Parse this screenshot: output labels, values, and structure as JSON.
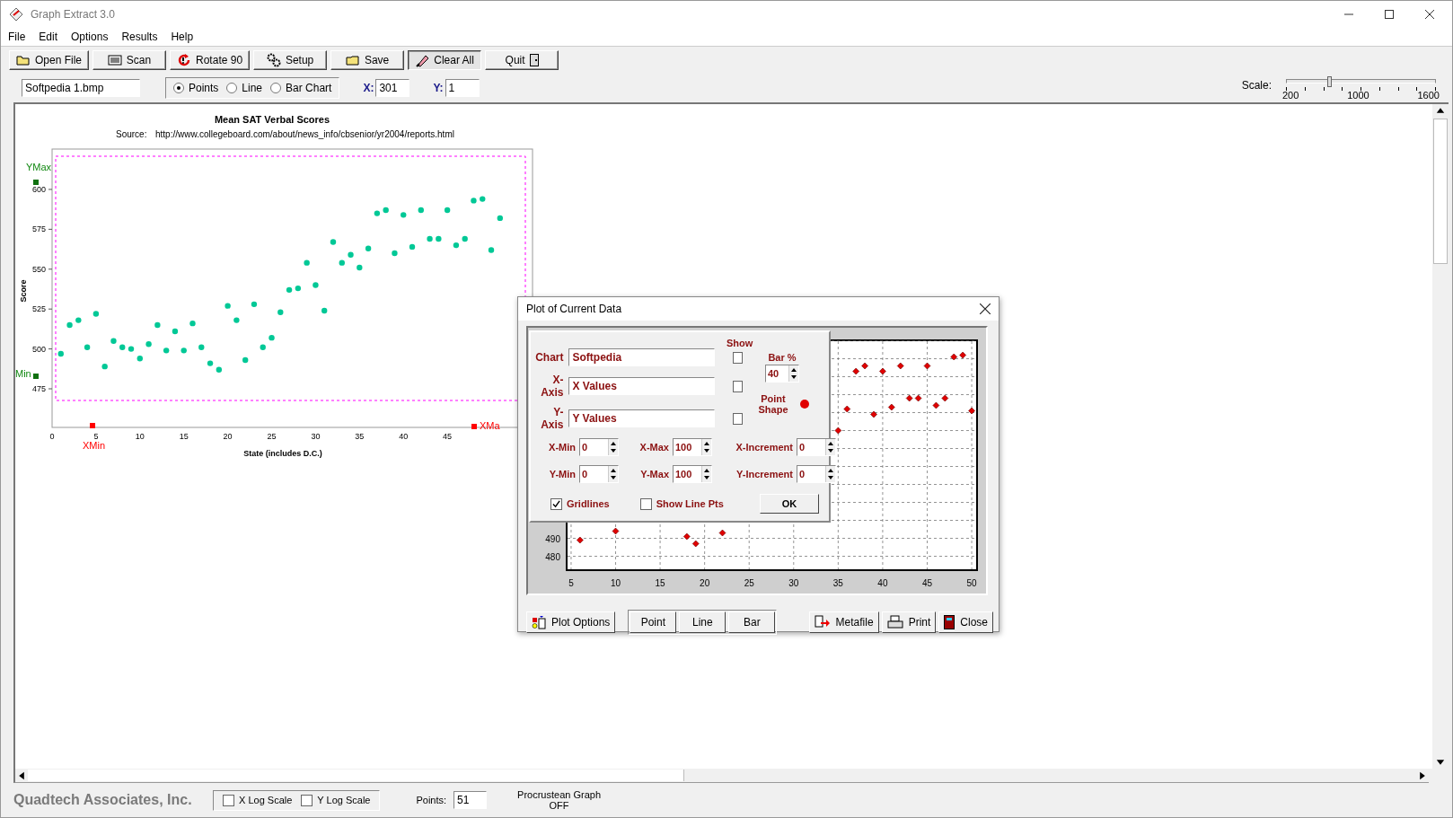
{
  "window": {
    "title": "Graph Extract 3.0"
  },
  "menu": [
    "File",
    "Edit",
    "Options",
    "Results",
    "Help"
  ],
  "toolbar": [
    {
      "label": "Open File",
      "kind": "folder",
      "pressed": false
    },
    {
      "label": "Scan",
      "kind": "scan",
      "pressed": false
    },
    {
      "label": "Rotate 90",
      "kind": "rotate",
      "pressed": false
    },
    {
      "label": "Setup",
      "kind": "gear",
      "pressed": false
    },
    {
      "label": "Save",
      "kind": "save",
      "pressed": false
    },
    {
      "label": "Clear All",
      "kind": "eraser",
      "pressed": true
    },
    {
      "label": "Quit",
      "kind": "door",
      "pressed": false
    }
  ],
  "file_field": {
    "value": "Softpedia 1.bmp"
  },
  "plot_type": [
    {
      "label": "Points",
      "selected": true
    },
    {
      "label": "Line",
      "selected": false
    },
    {
      "label": "Bar Chart",
      "selected": false
    }
  ],
  "x_field": {
    "label": "X:",
    "value": "301"
  },
  "y_field": {
    "label": "Y:",
    "value": "1"
  },
  "scale": {
    "label": "Scale:",
    "level": 0.29,
    "ticks": [
      "200",
      "1000",
      "1600"
    ]
  },
  "image_chart": {
    "title": "Mean SAT Verbal Scores",
    "source_label": "Source:",
    "source_url": "http://www.collegeboard.com/about/news_info/cbsenior/yr2004/reports.html",
    "markers": {
      "ymax": "YMax",
      "ymin": "Min",
      "xmin": "XMin",
      "xmax": "XMa"
    },
    "chart_data": {
      "type": "scatter",
      "xlabel": "State (includes D.C.)",
      "ylabel": "Score",
      "x": [
        1,
        2,
        3,
        4,
        5,
        6,
        7,
        8,
        9,
        10,
        11,
        12,
        13,
        14,
        15,
        16,
        17,
        18,
        19,
        20,
        21,
        22,
        23,
        24,
        25,
        26,
        27,
        28,
        29,
        30,
        31,
        32,
        33,
        34,
        35,
        36,
        37,
        38,
        39,
        40,
        41,
        42,
        43,
        44,
        45,
        46,
        47,
        48,
        49,
        50,
        51
      ],
      "series": [
        {
          "color": "#00c896",
          "values": [
            497,
            515,
            518,
            501,
            522,
            489,
            505,
            501,
            500,
            494,
            503,
            515,
            499,
            511,
            499,
            516,
            501,
            491,
            487,
            527,
            518,
            493,
            528,
            501,
            507,
            523,
            537,
            538,
            554,
            540,
            524,
            567,
            554,
            559,
            551,
            563,
            585,
            587,
            560,
            584,
            564,
            587,
            569,
            569,
            587,
            565,
            569,
            593,
            594,
            562,
            582
          ]
        }
      ],
      "xticks": [
        0,
        5,
        10,
        15,
        20,
        25,
        30,
        35,
        40,
        45
      ],
      "yticks": [
        475,
        500,
        525,
        550,
        575,
        600
      ],
      "xlim": [
        0,
        54.7
      ],
      "ylim": [
        450.8,
        625.3
      ]
    }
  },
  "dialog": {
    "title": "Plot of Current Data",
    "chart_data": {
      "type": "scatter",
      "x": [
        6,
        10,
        18,
        19,
        22,
        35,
        36,
        37,
        38,
        39,
        40,
        41,
        42,
        43,
        44,
        45,
        46,
        47,
        48,
        49,
        50
      ],
      "series": [
        {
          "color": "#e00000",
          "values": [
            489,
            494,
            491,
            487,
            493,
            550,
            562,
            583,
            586,
            559,
            583,
            563,
            586,
            568,
            568,
            586,
            564,
            568,
            591,
            592,
            561
          ]
        }
      ],
      "xticks": [
        5,
        10,
        15,
        20,
        25,
        30,
        35,
        40,
        45,
        50
      ],
      "yticks": [
        480,
        490
      ],
      "xlim": [
        4.5,
        50.6
      ],
      "ylim": [
        472.25,
        600.25
      ],
      "grid": true
    },
    "options": {
      "show_label": "Show",
      "fields": [
        {
          "label": "Chart",
          "value": "Softpedia",
          "show": false
        },
        {
          "label": "X-Axis",
          "value": "X Values",
          "show": false
        },
        {
          "label": "Y-Axis",
          "value": "Y Values",
          "show": false
        }
      ],
      "bar_percent": {
        "label": "Bar %",
        "value": "40"
      },
      "point_shape": {
        "label": "Point Shape",
        "color": "#e00000"
      },
      "ranges": [
        {
          "label": "X-Min",
          "value": "0"
        },
        {
          "label": "X-Max",
          "value": "100"
        },
        {
          "label": "X-Increment",
          "value": "0"
        },
        {
          "label": "Y-Min",
          "value": "0"
        },
        {
          "label": "Y-Max",
          "value": "100"
        },
        {
          "label": "Y-Increment",
          "value": "0"
        }
      ],
      "gridlines": {
        "label": "Gridlines",
        "checked": true
      },
      "show_line_pts": {
        "label": "Show Line Pts",
        "checked": false
      },
      "ok": "OK"
    },
    "buttons": [
      {
        "label": "Plot Options",
        "kind": "options"
      },
      {
        "label": "Point",
        "kind": "plain"
      },
      {
        "label": "Line",
        "kind": "plain"
      },
      {
        "label": "Bar",
        "kind": "plain"
      },
      {
        "label": "Metafile",
        "kind": "metafile"
      },
      {
        "label": "Print",
        "kind": "print"
      },
      {
        "label": "Close",
        "kind": "door"
      }
    ]
  },
  "status": {
    "company": "Quadtech Associates, Inc.",
    "log_scales": [
      {
        "label": "X Log Scale",
        "checked": false
      },
      {
        "label": "Y Log Scale",
        "checked": false
      }
    ],
    "points": {
      "label": "Points:",
      "value": "51"
    },
    "procrustes": {
      "label": "Procrustean Graph",
      "value": "OFF"
    }
  }
}
